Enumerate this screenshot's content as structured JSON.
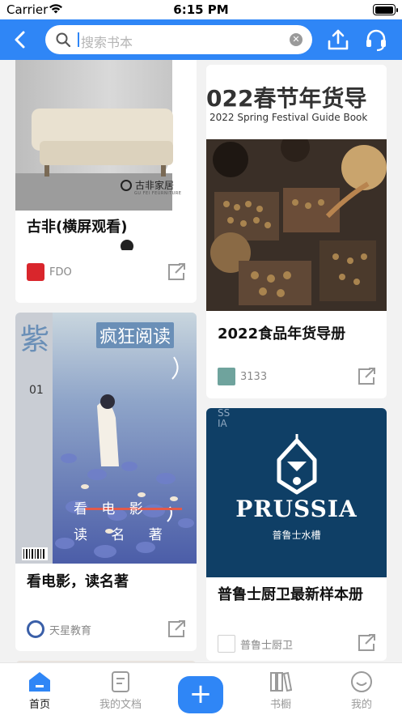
{
  "status_bar": {
    "carrier": "Carrier",
    "time": "6:15 PM"
  },
  "header": {
    "search_placeholder": "搜索书本"
  },
  "cards": [
    {
      "cover_brand": "古非家居",
      "cover_brand_sub": "GU FEI FEURNITURE",
      "title": "古非(横屏观看)",
      "publisher": "FDO"
    },
    {
      "cover_heading": "022春节年货导",
      "cover_subheading": "2022 Spring Festival Guide Book",
      "title": "2022食品年货导册",
      "publisher": "3133"
    },
    {
      "cover_masthead": "疯狂阅读",
      "cover_side": "紫",
      "cover_issue": "01",
      "cover_line1": "看 电 影",
      "cover_line2": "读 名 著",
      "title": "看电影，读名著",
      "publisher": "天星教育"
    },
    {
      "cover_brand": "PRUSSIA",
      "cover_brand_sub": "普鲁士水槽",
      "cover_corner": "SS IA",
      "title": "普鲁士厨卫最新样本册",
      "publisher": "普鲁士厨卫"
    }
  ],
  "tabbar": {
    "home": "首页",
    "docs": "我的文档",
    "plus": "+",
    "shelf": "书橱",
    "mine": "我的"
  },
  "colors": {
    "accent": "#2f86f6"
  }
}
